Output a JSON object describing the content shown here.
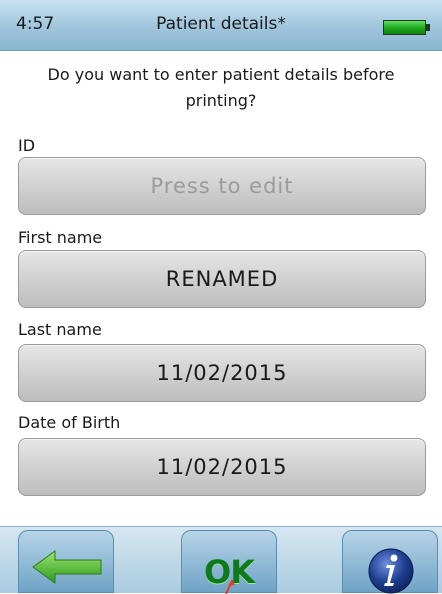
{
  "status": {
    "time": "4:57",
    "title": "Patient details*",
    "battery_icon": "battery-full-icon"
  },
  "prompt": "Do you want to enter patient details before printing?",
  "fields": [
    {
      "label": "ID",
      "value": "Press to edit",
      "is_placeholder": true
    },
    {
      "label": "First name",
      "value": "RENAMED",
      "is_placeholder": false
    },
    {
      "label": "Last name",
      "value": "11/02/2015",
      "is_placeholder": false
    },
    {
      "label": "Date of Birth",
      "value": "11/02/2015",
      "is_placeholder": false
    }
  ],
  "toolbar": {
    "back_icon": "back-arrow-icon",
    "ok_label": "OK",
    "info_icon": "info-icon"
  },
  "colors": {
    "status_bar": "#9fc5dc",
    "field_button": "#cfcfcf",
    "ok_green": "#0f7a1c",
    "back_arrow": "#57c03a",
    "info_blue": "#1d3d8f"
  }
}
